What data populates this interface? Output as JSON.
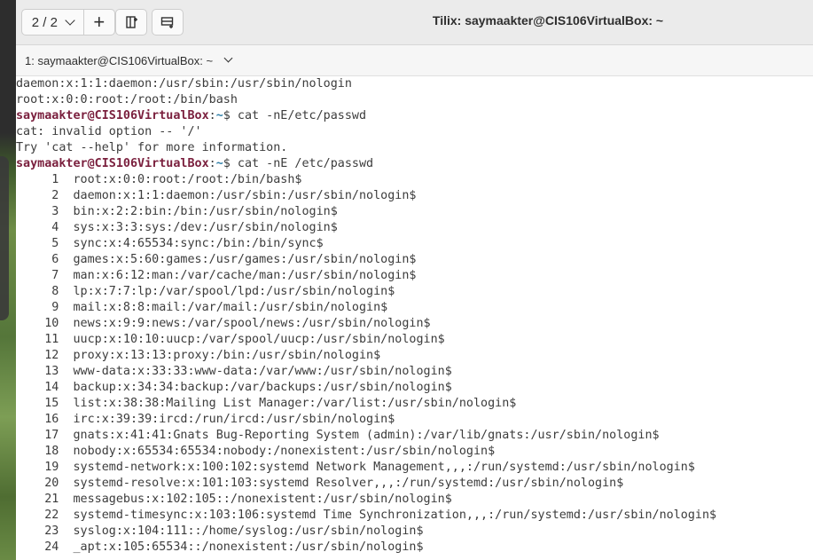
{
  "header": {
    "session_indicator": "2 / 2",
    "add_label": "+",
    "window_title": "Tilix: saymaakter@CIS106VirtualBox: ~"
  },
  "terminal_title": "1: saymaakter@CIS106VirtualBox: ~",
  "colors": {
    "prompt_user": "#7a1f3d",
    "prompt_path": "#2f7fa8",
    "text": "#3c3c3c",
    "headerbar": "#ebebeb"
  },
  "icons": [
    "chevron-down-icon",
    "add-session-icon",
    "split-horizontal-icon",
    "split-vertical-icon"
  ],
  "terminal": {
    "prompt_user_host": "saymaakter@CIS106VirtualBox",
    "prompt_path": "~",
    "lines": [
      {
        "type": "out",
        "text": "daemon:x:1:1:daemon:/usr/sbin:/usr/sbin/nologin"
      },
      {
        "type": "out",
        "text": "root:x:0:0:root:/root:/bin/bash"
      },
      {
        "type": "prompt",
        "cmd": "$ cat -nE/etc/passwd"
      },
      {
        "type": "out",
        "text": "cat: invalid option -- '/'"
      },
      {
        "type": "out",
        "text": "Try 'cat --help' for more information."
      },
      {
        "type": "prompt",
        "cmd": "$ cat -nE /etc/passwd"
      },
      {
        "type": "out",
        "text": "     1\troot:x:0:0:root:/root:/bin/bash$"
      },
      {
        "type": "out",
        "text": "     2\tdaemon:x:1:1:daemon:/usr/sbin:/usr/sbin/nologin$"
      },
      {
        "type": "out",
        "text": "     3\tbin:x:2:2:bin:/bin:/usr/sbin/nologin$"
      },
      {
        "type": "out",
        "text": "     4\tsys:x:3:3:sys:/dev:/usr/sbin/nologin$"
      },
      {
        "type": "out",
        "text": "     5\tsync:x:4:65534:sync:/bin:/bin/sync$"
      },
      {
        "type": "out",
        "text": "     6\tgames:x:5:60:games:/usr/games:/usr/sbin/nologin$"
      },
      {
        "type": "out",
        "text": "     7\tman:x:6:12:man:/var/cache/man:/usr/sbin/nologin$"
      },
      {
        "type": "out",
        "text": "     8\tlp:x:7:7:lp:/var/spool/lpd:/usr/sbin/nologin$"
      },
      {
        "type": "out",
        "text": "     9\tmail:x:8:8:mail:/var/mail:/usr/sbin/nologin$"
      },
      {
        "type": "out",
        "text": "    10\tnews:x:9:9:news:/var/spool/news:/usr/sbin/nologin$"
      },
      {
        "type": "out",
        "text": "    11\tuucp:x:10:10:uucp:/var/spool/uucp:/usr/sbin/nologin$"
      },
      {
        "type": "out",
        "text": "    12\tproxy:x:13:13:proxy:/bin:/usr/sbin/nologin$"
      },
      {
        "type": "out",
        "text": "    13\twww-data:x:33:33:www-data:/var/www:/usr/sbin/nologin$"
      },
      {
        "type": "out",
        "text": "    14\tbackup:x:34:34:backup:/var/backups:/usr/sbin/nologin$"
      },
      {
        "type": "out",
        "text": "    15\tlist:x:38:38:Mailing List Manager:/var/list:/usr/sbin/nologin$"
      },
      {
        "type": "out",
        "text": "    16\tirc:x:39:39:ircd:/run/ircd:/usr/sbin/nologin$"
      },
      {
        "type": "out",
        "text": "    17\tgnats:x:41:41:Gnats Bug-Reporting System (admin):/var/lib/gnats:/usr/sbin/nologin$"
      },
      {
        "type": "out",
        "text": "    18\tnobody:x:65534:65534:nobody:/nonexistent:/usr/sbin/nologin$"
      },
      {
        "type": "out",
        "text": "    19\tsystemd-network:x:100:102:systemd Network Management,,,:/run/systemd:/usr/sbin/nologin$"
      },
      {
        "type": "out",
        "text": "    20\tsystemd-resolve:x:101:103:systemd Resolver,,,:/run/systemd:/usr/sbin/nologin$"
      },
      {
        "type": "out",
        "text": "    21\tmessagebus:x:102:105::/nonexistent:/usr/sbin/nologin$"
      },
      {
        "type": "out",
        "text": "    22\tsystemd-timesync:x:103:106:systemd Time Synchronization,,,:/run/systemd:/usr/sbin/nologin$"
      },
      {
        "type": "out",
        "text": "    23\tsyslog:x:104:111::/home/syslog:/usr/sbin/nologin$"
      },
      {
        "type": "out",
        "text": "    24\t_apt:x:105:65534::/nonexistent:/usr/sbin/nologin$"
      }
    ]
  }
}
